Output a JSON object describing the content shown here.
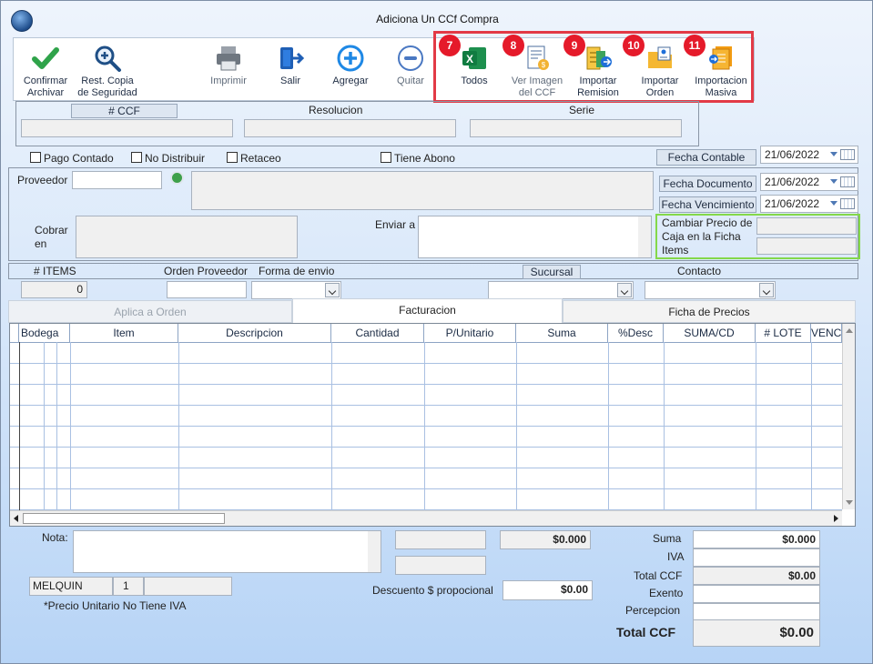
{
  "window": {
    "title": "Adiciona Un CCf Compra"
  },
  "toolbar": {
    "confirm": "Confirmar Archivar",
    "backup": "Rest. Copia de Seguridad",
    "print": "Imprimir",
    "exit": "Salir",
    "add": "Agregar",
    "remove": "Quitar",
    "all": "Todos",
    "view_image": "Ver Imagen del CCF",
    "import_remision": "Importar Remision",
    "import_order": "Importar Orden",
    "mass_import": "Importacion Masiva"
  },
  "badges": [
    "7",
    "8",
    "9",
    "10",
    "11"
  ],
  "top_fields": {
    "ccf_label": "# CCF",
    "resolucion_label": "Resolucion",
    "serie_label": "Serie"
  },
  "checks": {
    "pago_contado": "Pago Contado",
    "no_distribuir": "No Distribuir",
    "retaceo": "Retaceo",
    "tiene_abono": "Tiene Abono"
  },
  "dates": {
    "fecha_contable_label": "Fecha Contable",
    "fecha_contable": "21/06/2022",
    "fecha_documento_label": "Fecha Documento",
    "fecha_documento": "21/06/2022",
    "fecha_vencimiento_label": "Fecha Vencimiento",
    "fecha_vencimiento": "21/06/2022"
  },
  "form": {
    "proveedor_label": "Proveedor",
    "cobrar_label": "Cobrar en",
    "enviar_label": "Enviar a",
    "cambiar_precio": "Cambiar Precio de Caja en la Ficha Items"
  },
  "info_row": {
    "items_label": "# ITEMS",
    "items_value": "0",
    "orden_proveedor_label": "Orden Proveedor",
    "forma_envio_label": "Forma de envio",
    "sucursal_label": "Sucursal",
    "contacto_label": "Contacto"
  },
  "tabs": {
    "aplica": "Aplica a Orden",
    "facturacion": "Facturacion",
    "ficha": "Ficha de Precios"
  },
  "grid": {
    "columns": [
      "Bodega",
      "Item",
      "Descripcion",
      "Cantidad",
      "P/Unitario",
      "Suma",
      "%Desc",
      "SUMA/CD",
      "# LOTE",
      "VENC"
    ]
  },
  "footer": {
    "nota_label": "Nota:",
    "user": "MELQUIN",
    "user_num": "1",
    "iva_note": "*Precio Unitario No Tiene IVA",
    "mid_amount": "$0.000",
    "descuento_label": "Descuento $ propocional",
    "descuento_value": "$0.00"
  },
  "totals": {
    "suma_label": "Suma",
    "suma_value": "$0.000",
    "iva_label": "IVA",
    "total_ccf_small_label": "Total CCF",
    "total_ccf_small_value": "$0.00",
    "exento_label": "Exento",
    "percepcion_label": "Percepcion",
    "total_ccf_label": "Total CCF",
    "total_ccf_value": "$0.00"
  }
}
